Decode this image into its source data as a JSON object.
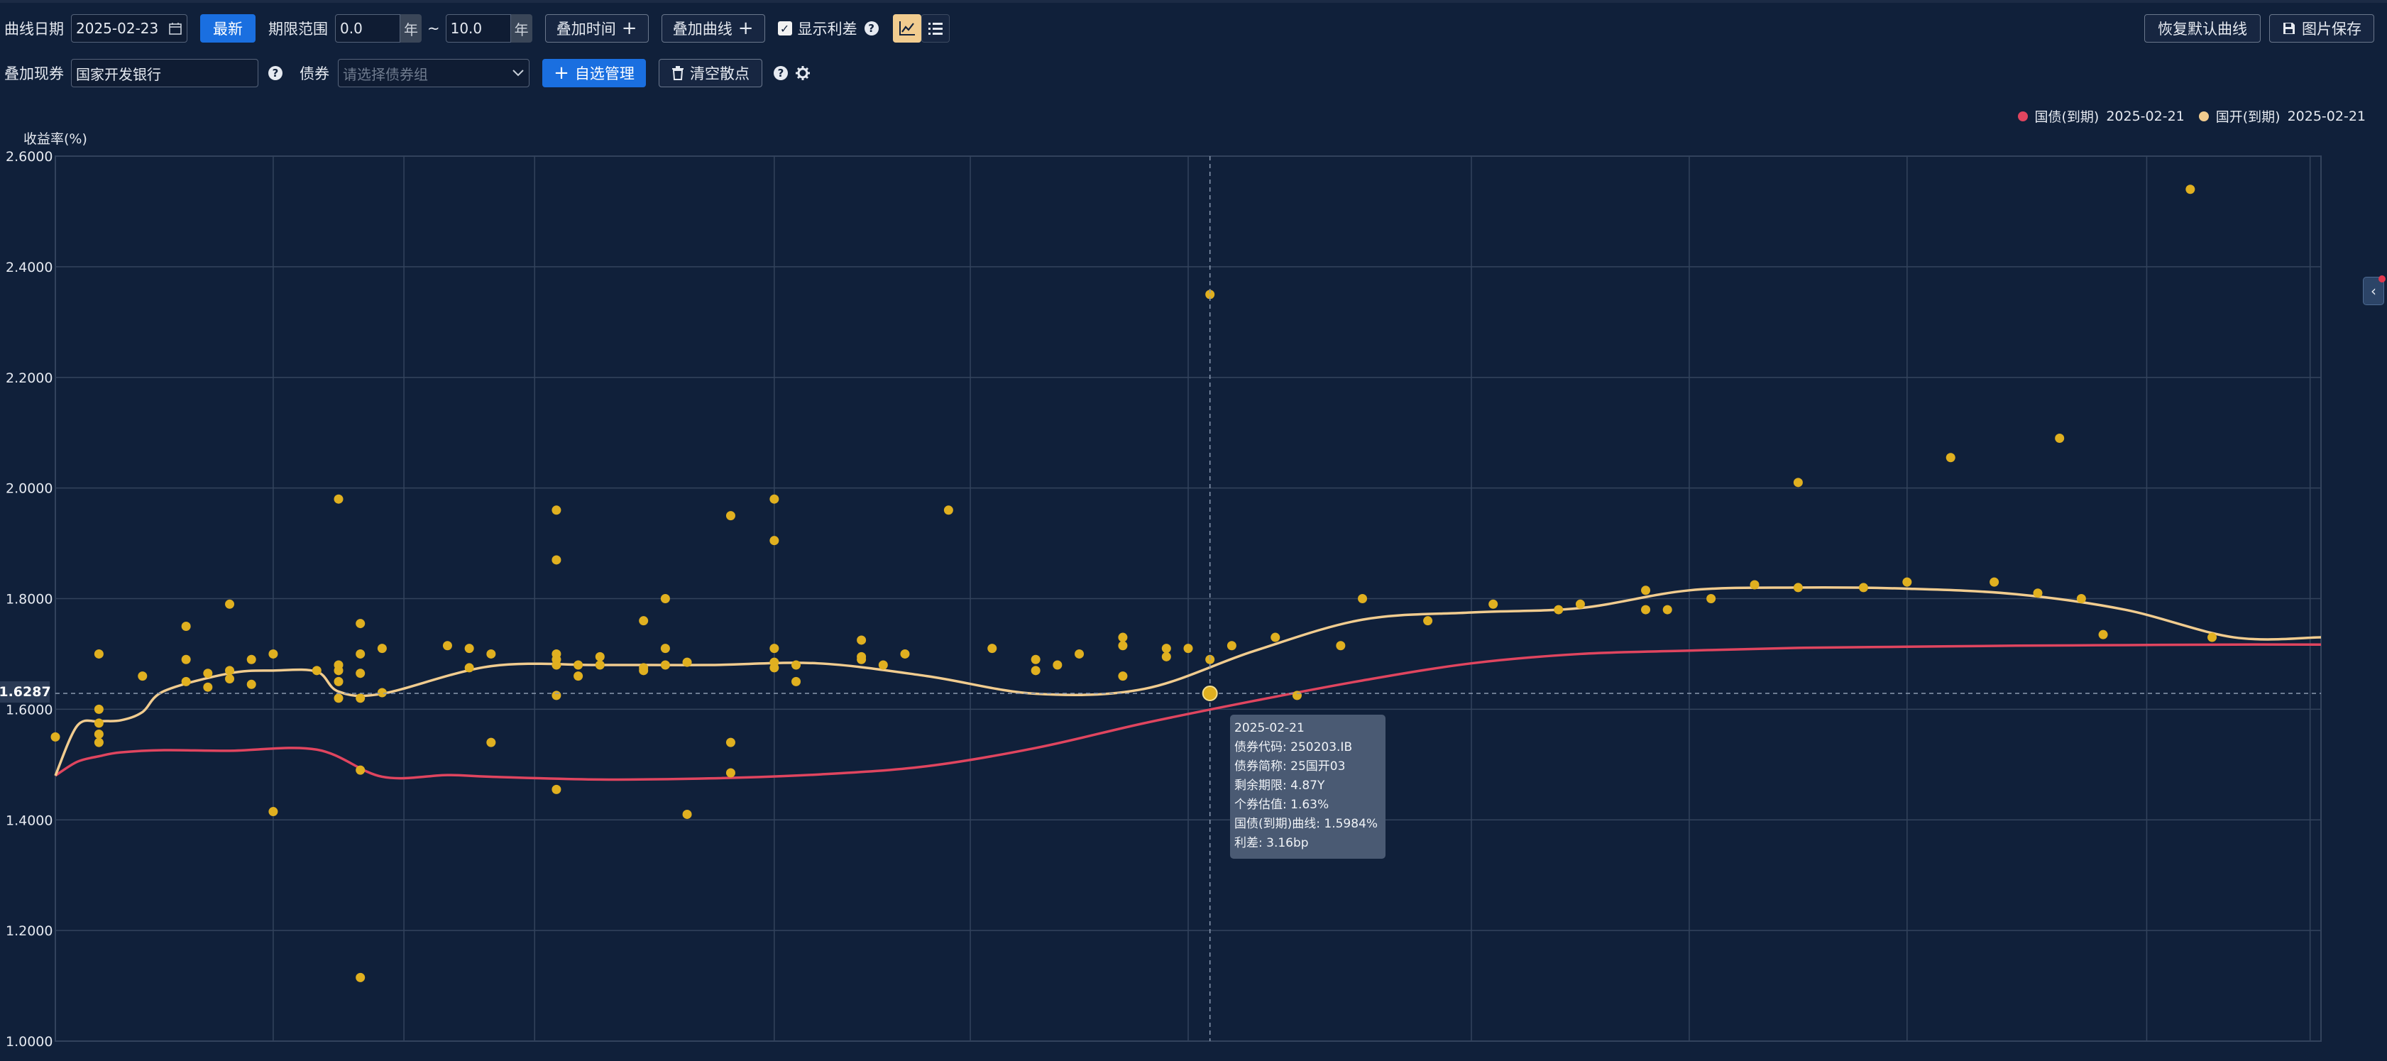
{
  "toolbar": {
    "curve_date_label": "曲线日期",
    "curve_date_value": "2025-02-23",
    "latest_label": "最新",
    "term_range_label": "期限范围",
    "term_from": "0.0",
    "term_to": "10.0",
    "year_unit": "年",
    "range_sep": "~",
    "add_time_label": "叠加时间",
    "add_curve_label": "叠加曲线",
    "show_spread_label": "显示利差",
    "show_spread_checked": true,
    "restore_label": "恢复默认曲线",
    "save_image_label": "图片保存",
    "plus_glyph": "+"
  },
  "filter": {
    "spot_label": "叠加现券",
    "spot_value": "国家开发银行",
    "bond_label": "债券",
    "bond_placeholder": "请选择债券组",
    "manage_label": "自选管理",
    "clear_label": "清空散点"
  },
  "icons": {
    "calendar": "calendar-icon",
    "help": "help-icon",
    "line_chart": "line-chart-icon",
    "list": "list-icon",
    "gear": "gear-icon",
    "save": "floppy-icon",
    "trash": "trash-icon",
    "chevron": "chevron-left-icon"
  },
  "legend": [
    {
      "label": "国债(到期)",
      "date": "2025-02-21",
      "color": "#e0455f"
    },
    {
      "label": "国开(到期)",
      "date": "2025-02-21",
      "color": "#f1cc8f"
    }
  ],
  "colors": {
    "treasury": "#e0455f",
    "cdb": "#f1cc8f",
    "scatter": "#e0b020",
    "accent": "#1a6fe0"
  },
  "crosshair_value": "1.6287",
  "tooltip": {
    "date": "2025-02-21",
    "lines": [
      "债券代码:  250203.IB",
      "债券简称:  25国开03",
      "剩余期限:  4.87Y",
      "个券估值:  1.63%",
      "国债(到期)曲线:  1.5984%",
      "利差:  3.16bp"
    ]
  },
  "chart_data": {
    "type": "line",
    "ylabel": "收益率(%)",
    "ylim": [
      1.0,
      2.6
    ],
    "yticks": [
      "1.0000",
      "1.2000",
      "1.4000",
      "1.6000",
      "1.8000",
      "2.0000",
      "2.2000",
      "2.4000",
      "2.6000"
    ],
    "xlim": [
      0,
      10.4
    ],
    "grid": true,
    "legend_position": "top-right",
    "series": [
      {
        "name": "国债(到期)",
        "x": [
          0.0,
          0.1,
          0.2,
          0.3,
          0.5,
          0.8,
          1.2,
          1.5,
          1.8,
          2.0,
          2.5,
          3.0,
          3.5,
          4.0,
          4.5,
          5.0,
          5.5,
          6.0,
          6.5,
          7.0,
          7.5,
          8.0,
          8.5,
          9.0,
          9.5,
          10.0,
          10.4
        ],
        "values": [
          1.48,
          1.505,
          1.515,
          1.522,
          1.526,
          1.525,
          1.527,
          1.478,
          1.481,
          1.478,
          1.473,
          1.475,
          1.482,
          1.497,
          1.53,
          1.575,
          1.615,
          1.652,
          1.683,
          1.7,
          1.706,
          1.711,
          1.713,
          1.715,
          1.716,
          1.717,
          1.717
        ]
      },
      {
        "name": "国开(到期)",
        "x": [
          0.0,
          0.1,
          0.2,
          0.3,
          0.4,
          0.5,
          0.8,
          1.0,
          1.2,
          1.3,
          1.5,
          2.0,
          2.5,
          3.0,
          3.5,
          4.0,
          4.5,
          5.0,
          5.5,
          6.0,
          6.5,
          7.0,
          7.5,
          8.0,
          8.5,
          9.0,
          9.5,
          10.0,
          10.4
        ],
        "values": [
          1.48,
          1.57,
          1.578,
          1.58,
          1.595,
          1.633,
          1.665,
          1.67,
          1.668,
          1.632,
          1.628,
          1.678,
          1.68,
          1.68,
          1.683,
          1.66,
          1.628,
          1.637,
          1.705,
          1.762,
          1.775,
          1.783,
          1.815,
          1.82,
          1.818,
          1.808,
          1.78,
          1.73,
          1.73
        ]
      }
    ],
    "scatter": {
      "name": "国家开发银行",
      "points": [
        [
          0.0,
          1.55
        ],
        [
          0.2,
          1.7
        ],
        [
          0.2,
          1.6
        ],
        [
          0.2,
          1.575
        ],
        [
          0.2,
          1.555
        ],
        [
          0.2,
          1.54
        ],
        [
          0.4,
          1.66
        ],
        [
          0.6,
          1.75
        ],
        [
          0.6,
          1.69
        ],
        [
          0.6,
          1.65
        ],
        [
          0.7,
          1.665
        ],
        [
          0.7,
          1.64
        ],
        [
          0.8,
          1.79
        ],
        [
          0.8,
          1.67
        ],
        [
          0.8,
          1.655
        ],
        [
          0.9,
          1.69
        ],
        [
          0.9,
          1.645
        ],
        [
          1.0,
          1.7
        ],
        [
          1.0,
          1.415
        ],
        [
          1.2,
          1.67
        ],
        [
          1.3,
          1.98
        ],
        [
          1.3,
          1.68
        ],
        [
          1.3,
          1.67
        ],
        [
          1.3,
          1.65
        ],
        [
          1.3,
          1.62
        ],
        [
          1.4,
          1.755
        ],
        [
          1.4,
          1.7
        ],
        [
          1.4,
          1.665
        ],
        [
          1.4,
          1.62
        ],
        [
          1.4,
          1.49
        ],
        [
          1.4,
          1.115
        ],
        [
          1.5,
          1.71
        ],
        [
          1.5,
          1.63
        ],
        [
          1.8,
          1.715
        ],
        [
          1.9,
          1.71
        ],
        [
          1.9,
          1.675
        ],
        [
          2.0,
          1.7
        ],
        [
          2.0,
          1.54
        ],
        [
          2.3,
          1.96
        ],
        [
          2.3,
          1.87
        ],
        [
          2.3,
          1.7
        ],
        [
          2.3,
          1.69
        ],
        [
          2.3,
          1.68
        ],
        [
          2.3,
          1.625
        ],
        [
          2.3,
          1.455
        ],
        [
          2.4,
          1.68
        ],
        [
          2.4,
          1.66
        ],
        [
          2.5,
          1.695
        ],
        [
          2.5,
          1.68
        ],
        [
          2.7,
          1.76
        ],
        [
          2.7,
          1.675
        ],
        [
          2.7,
          1.67
        ],
        [
          2.8,
          1.8
        ],
        [
          2.8,
          1.71
        ],
        [
          2.8,
          1.68
        ],
        [
          2.9,
          1.685
        ],
        [
          2.9,
          1.41
        ],
        [
          3.1,
          1.95
        ],
        [
          3.1,
          1.54
        ],
        [
          3.1,
          1.485
        ],
        [
          3.3,
          1.98
        ],
        [
          3.3,
          1.905
        ],
        [
          3.3,
          1.71
        ],
        [
          3.3,
          1.685
        ],
        [
          3.3,
          1.675
        ],
        [
          3.4,
          1.68
        ],
        [
          3.4,
          1.65
        ],
        [
          3.7,
          1.725
        ],
        [
          3.7,
          1.695
        ],
        [
          3.7,
          1.69
        ],
        [
          3.8,
          1.68
        ],
        [
          3.9,
          1.7
        ],
        [
          4.1,
          1.96
        ],
        [
          4.3,
          1.71
        ],
        [
          4.5,
          1.69
        ],
        [
          4.5,
          1.67
        ],
        [
          4.6,
          1.68
        ],
        [
          4.7,
          1.7
        ],
        [
          4.9,
          1.73
        ],
        [
          4.9,
          1.715
        ],
        [
          4.9,
          1.66
        ],
        [
          5.1,
          1.71
        ],
        [
          5.1,
          1.695
        ],
        [
          5.2,
          1.71
        ],
        [
          5.3,
          2.35
        ],
        [
          5.3,
          1.69
        ],
        [
          5.4,
          1.715
        ],
        [
          5.6,
          1.73
        ],
        [
          5.7,
          1.625
        ],
        [
          5.9,
          1.715
        ],
        [
          6.0,
          1.8
        ],
        [
          6.3,
          1.76
        ],
        [
          6.6,
          1.79
        ],
        [
          6.9,
          1.78
        ],
        [
          7.0,
          1.79
        ],
        [
          7.3,
          1.815
        ],
        [
          7.3,
          1.78
        ],
        [
          7.4,
          1.78
        ],
        [
          7.6,
          1.8
        ],
        [
          7.8,
          1.825
        ],
        [
          8.0,
          2.01
        ],
        [
          8.0,
          1.82
        ],
        [
          8.3,
          1.82
        ],
        [
          8.5,
          1.83
        ],
        [
          8.7,
          2.055
        ],
        [
          8.9,
          1.83
        ],
        [
          9.1,
          1.81
        ],
        [
          9.2,
          2.09
        ],
        [
          9.3,
          1.8
        ],
        [
          9.4,
          1.735
        ],
        [
          9.8,
          2.54
        ],
        [
          9.9,
          1.73
        ]
      ],
      "highlight": [
        5.3,
        1.6287
      ]
    }
  }
}
